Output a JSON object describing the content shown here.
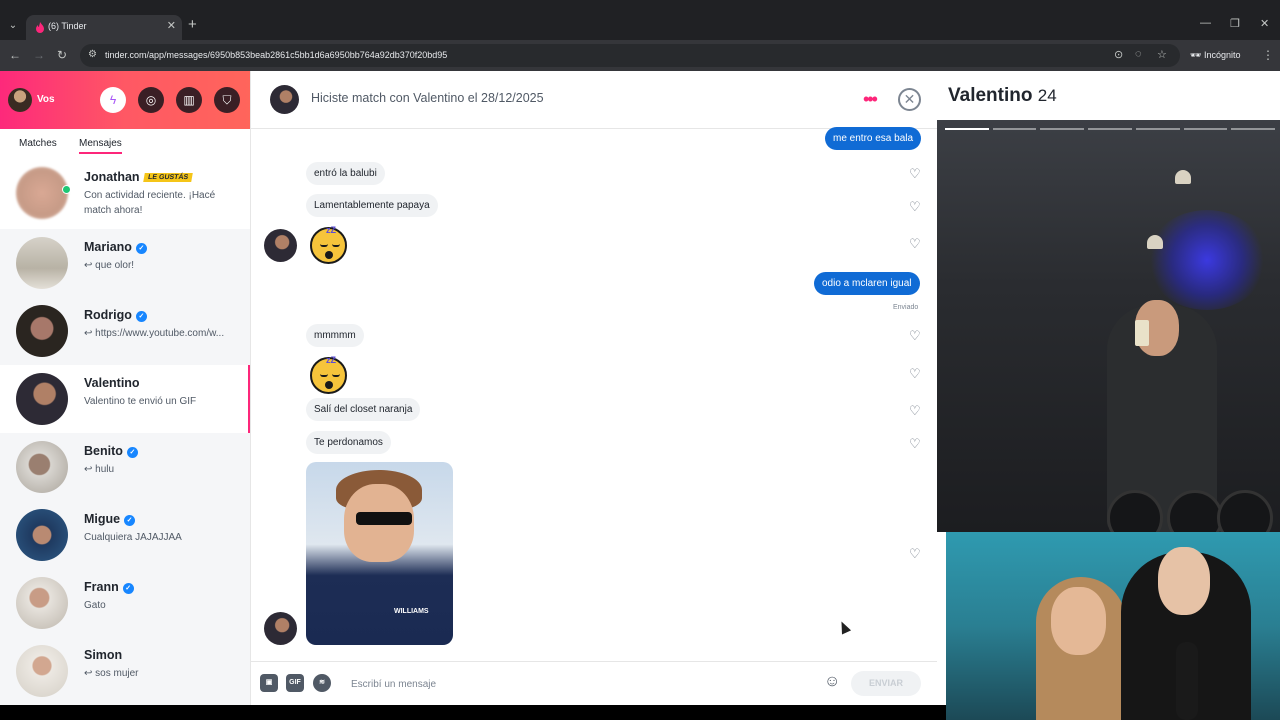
{
  "browser": {
    "tab_title": "(6) Tinder",
    "url": "tinder.com/app/messages/6950b853beab2861c5bb1d6a6950bb764a92db370f20bd95",
    "incognito_label": "Incógnito"
  },
  "sidebar": {
    "user_name": "Vos",
    "tabs": [
      "Matches",
      "Mensajes"
    ],
    "conversations": [
      {
        "name": "Jonathan",
        "badge": "LE GUSTÁS",
        "preview": "Con actividad reciente. ¡Hacé match ahora!"
      },
      {
        "name": "Mariano",
        "preview": "↩ que olor!"
      },
      {
        "name": "Rodrigo",
        "preview": "↩ https://www.youtube.com/w..."
      },
      {
        "name": "Valentino",
        "preview": "Valentino te envió un GIF"
      },
      {
        "name": "Benito",
        "preview": "↩ hulu"
      },
      {
        "name": "Migue",
        "preview": "Cualquiera JAJAJJAA"
      },
      {
        "name": "Frann",
        "preview": "Gato"
      },
      {
        "name": "Simon",
        "preview": "↩ sos mujer"
      }
    ]
  },
  "chat": {
    "header_title": "Hiciste match con Valentino el 28/12/2025",
    "messages": {
      "m1": "me entro esa bala",
      "m2": "entró la balubi",
      "m3": "Lamentablemente papaya",
      "m4": "odio a mclaren igual",
      "m5": "mmmmm",
      "m6": "Salí del closet naranja",
      "m7": "Te perdonamos"
    },
    "sent_label": "Enviado",
    "gif_caption": "WILLIAMS",
    "input_placeholder": "Escribí un mensaje",
    "gif_button": "GIF",
    "send_label": "ENVIAR"
  },
  "profile": {
    "name": "Valentino",
    "age": "24",
    "photo_count": 7,
    "photo_index": 1
  },
  "colors": {
    "brand_pink": "#fd267a",
    "outgoing_bubble": "#106bd5",
    "incoming_bubble": "#f0f2f4"
  }
}
